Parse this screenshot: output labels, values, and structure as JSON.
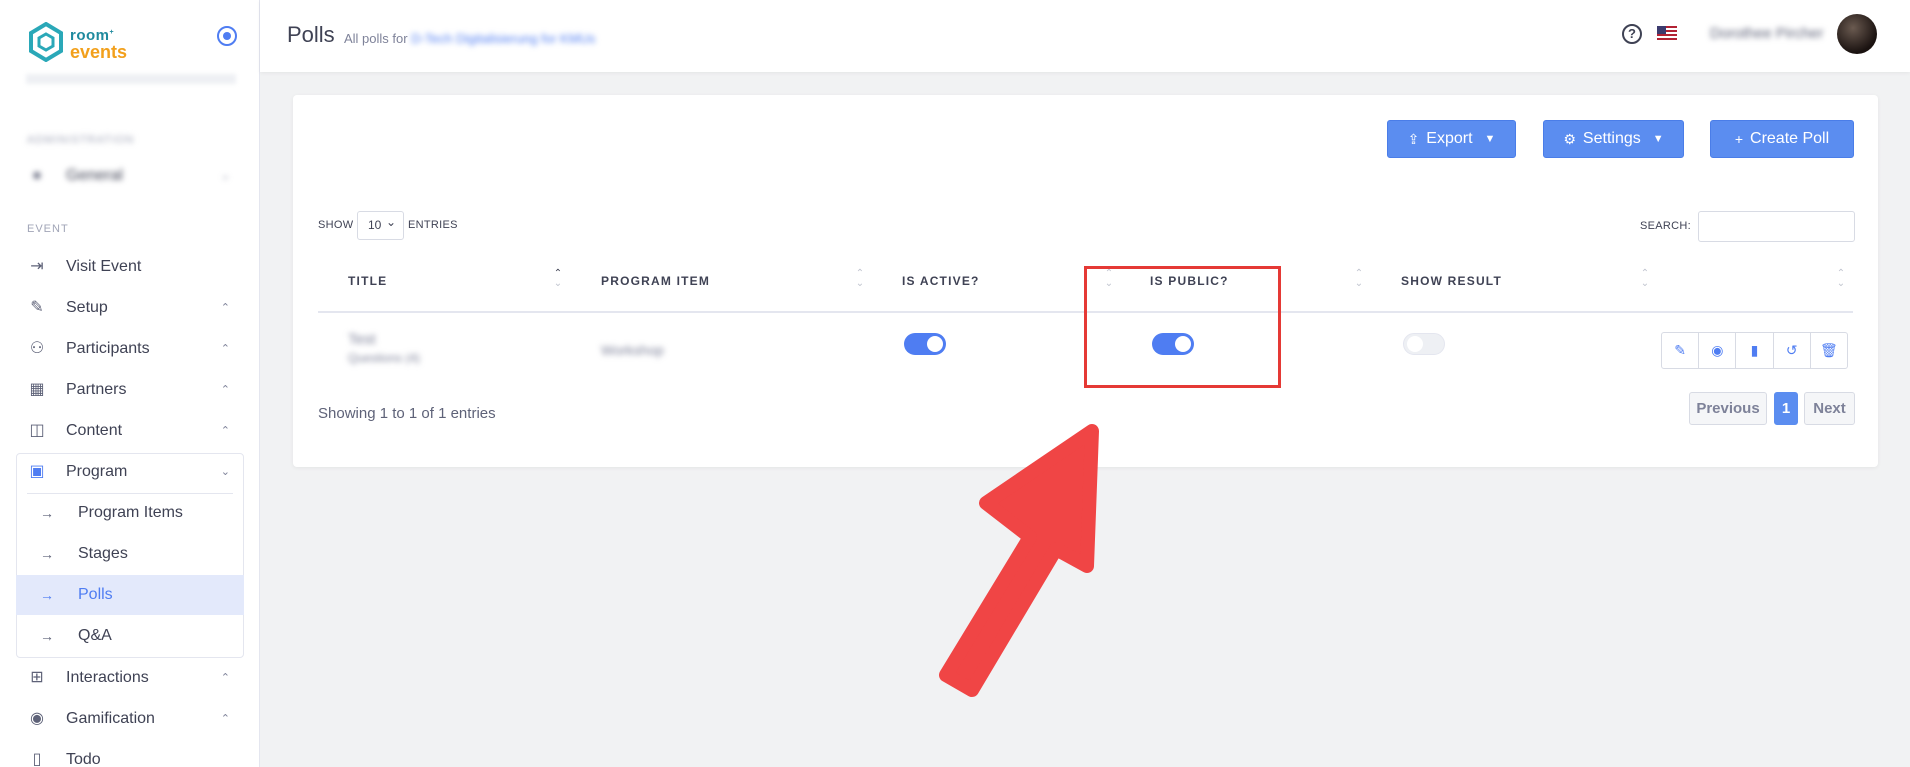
{
  "sidebar": {
    "logo": {
      "line1": "room",
      "line1_sup": "+",
      "line2": "events"
    },
    "admin_label": "ADMINISTRATION",
    "general_label": "General",
    "event_label": "EVENT",
    "items": [
      {
        "label": "Visit Event",
        "icon": "arrow-in-icon"
      },
      {
        "label": "Setup",
        "icon": "pencil-icon"
      },
      {
        "label": "Participants",
        "icon": "users-icon"
      },
      {
        "label": "Partners",
        "icon": "building-icon"
      },
      {
        "label": "Content",
        "icon": "layout-icon"
      },
      {
        "label": "Program",
        "icon": "calendar-icon"
      },
      {
        "label": "Interactions",
        "icon": "plus-square-icon"
      },
      {
        "label": "Gamification",
        "icon": "gamepad-icon"
      },
      {
        "label": "Todo",
        "icon": "clipboard-icon"
      }
    ],
    "program_sub": [
      {
        "label": "Program Items"
      },
      {
        "label": "Stages"
      },
      {
        "label": "Polls",
        "active": true
      },
      {
        "label": "Q&A"
      }
    ]
  },
  "header": {
    "title": "Polls",
    "subtitle_prefix": "All polls for",
    "subtitle_event": "D-Tech Digitalisierung for KMUs",
    "user_name": "Dorothee Pircher"
  },
  "toolbar": {
    "export_label": "Export",
    "settings_label": "Settings",
    "create_label": "Create Poll"
  },
  "table_controls": {
    "show_label": "SHOW",
    "entries_value": "10",
    "entries_label": "ENTRIES",
    "search_label": "SEARCH:"
  },
  "table": {
    "columns": [
      "TITLE",
      "PROGRAM ITEM",
      "IS ACTIVE?",
      "IS PUBLIC?",
      "SHOW RESULT"
    ],
    "rows": [
      {
        "title": "Test",
        "subtitle": "Questions (4)",
        "program_item": "Workshop",
        "is_active": true,
        "is_public": true,
        "show_result": false
      }
    ]
  },
  "footer": {
    "showing": "Showing 1 to 1 of 1 entries",
    "previous": "Previous",
    "page": "1",
    "next": "Next"
  },
  "colors": {
    "accent": "#4f7df2",
    "button": "#5b8df0",
    "annotation": "#e53935"
  }
}
